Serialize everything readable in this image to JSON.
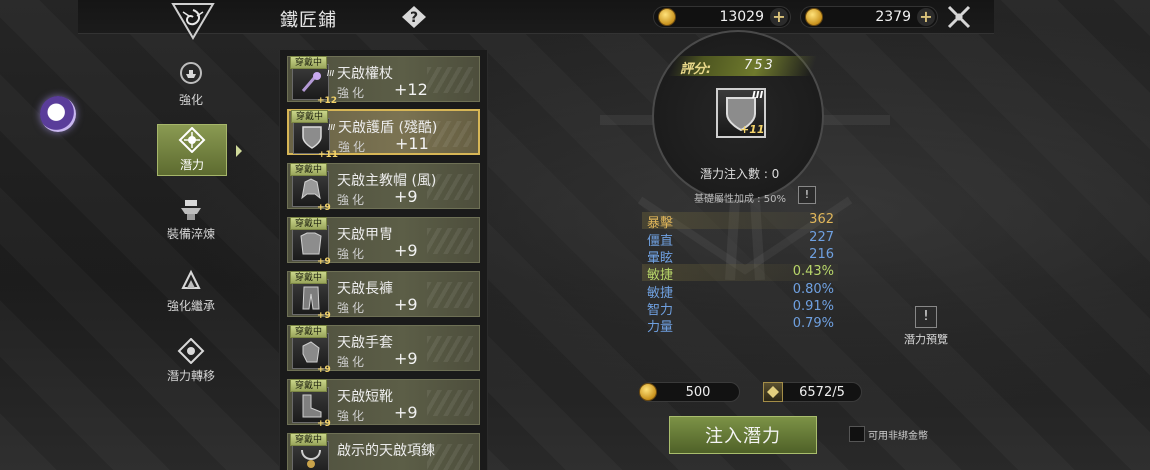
{
  "header": {
    "title": "鐵匠鋪",
    "help_icon": "question-mark-icon",
    "currency_1": {
      "icon": "coin-stack-icon",
      "value": "13029"
    },
    "currency_2": {
      "icon": "coin-icon",
      "value": "2379"
    },
    "close_icon": "crossed-swords-close-icon"
  },
  "sidebar": {
    "items": [
      {
        "label": "強化",
        "icon": "anvil-icon"
      },
      {
        "label": "潛力",
        "icon": "potential-icon"
      },
      {
        "label": "裝備淬煉",
        "icon": "forge-icon"
      },
      {
        "label": "強化繼承",
        "icon": "inherit-icon"
      },
      {
        "label": "潛力轉移",
        "icon": "transfer-icon"
      }
    ]
  },
  "equipment_list": [
    {
      "badge": "穿戴中",
      "roman": "III",
      "small_plus": "+12",
      "name": "天啟權杖",
      "label": "強化",
      "level": "+12",
      "icon": "scepter-icon"
    },
    {
      "badge": "穿戴中",
      "roman": "III",
      "small_plus": "+11",
      "name": "天啟護盾 (殘酷)",
      "label": "強化",
      "level": "+11",
      "icon": "shield-icon"
    },
    {
      "badge": "穿戴中",
      "roman": "",
      "small_plus": "+9",
      "name": "天啟主教帽 (風)",
      "label": "強化",
      "level": "+9",
      "icon": "helmet-icon"
    },
    {
      "badge": "穿戴中",
      "roman": "",
      "small_plus": "+9",
      "name": "天啟甲冑",
      "label": "強化",
      "level": "+9",
      "icon": "armor-icon"
    },
    {
      "badge": "穿戴中",
      "roman": "",
      "small_plus": "+9",
      "name": "天啟長褲",
      "label": "強化",
      "level": "+9",
      "icon": "pants-icon"
    },
    {
      "badge": "穿戴中",
      "roman": "",
      "small_plus": "+9",
      "name": "天啟手套",
      "label": "強化",
      "level": "+9",
      "icon": "gloves-icon"
    },
    {
      "badge": "穿戴中",
      "roman": "",
      "small_plus": "+9",
      "name": "天啟短靴",
      "label": "強化",
      "level": "+9",
      "icon": "boots-icon"
    },
    {
      "badge": "穿戴中",
      "roman": "",
      "small_plus": "",
      "name": "啟示的天啟項鍊",
      "label": "",
      "level": "",
      "icon": "necklace-icon"
    }
  ],
  "detail": {
    "score_label": "評分:",
    "score_value": "753",
    "item_roman": "III",
    "item_plus": "+11",
    "inject_count": "潛力注入數 : 0",
    "base_bonus": "基礎屬性加成 : 50%",
    "info_mark": "!",
    "stats": [
      {
        "name": "暴擊",
        "value": "362",
        "name_color": "#e0b65a",
        "value_color": "#e0b65a",
        "highlight": true
      },
      {
        "name": "僵直",
        "value": "227",
        "name_color": "#6fa0e0",
        "value_color": "#6fa0e0",
        "highlight": false
      },
      {
        "name": "暈眩",
        "value": "216",
        "name_color": "#6fa0e0",
        "value_color": "#6fa0e0",
        "highlight": false
      },
      {
        "name": "敏捷",
        "value": "0.43%",
        "name_color": "#b8d66a",
        "value_color": "#b8d66a",
        "highlight": true
      },
      {
        "name": "敏捷",
        "value": "0.80%",
        "name_color": "#6fa0e0",
        "value_color": "#6fa0e0",
        "highlight": false
      },
      {
        "name": "智力",
        "value": "0.91%",
        "name_color": "#6fa0e0",
        "value_color": "#6fa0e0",
        "highlight": false
      },
      {
        "name": "力量",
        "value": "0.79%",
        "name_color": "#6fa0e0",
        "value_color": "#6fa0e0",
        "highlight": false
      }
    ],
    "preview_label": "潛力預覽",
    "preview_mark": "!"
  },
  "footer": {
    "cost_gold": "500",
    "cost_material": "6572/5",
    "inject_button": "注入潛力",
    "checkbox_label": "可用非綁金幣"
  }
}
